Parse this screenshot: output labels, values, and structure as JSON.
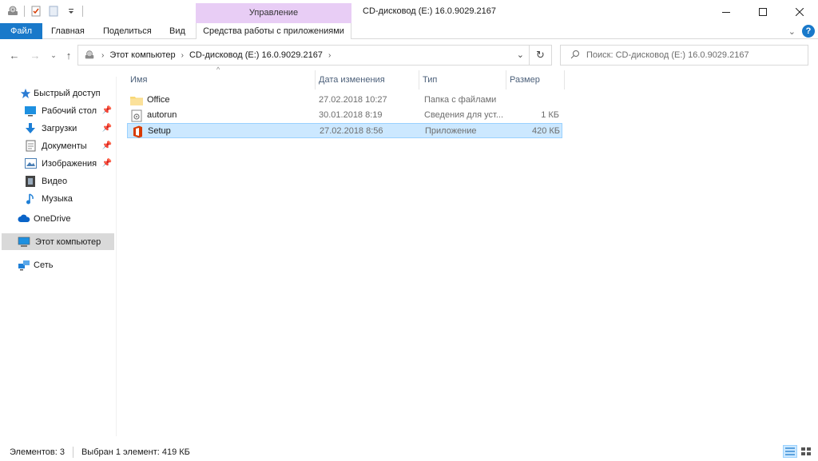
{
  "titlebar": {
    "context_group": "Управление",
    "title": "CD-дисковод (E:) 16.0.9029.2167",
    "qat_icons": [
      "drive-icon",
      "checkmark-doc-icon",
      "blank-doc-icon",
      "customize-dropdown-icon"
    ]
  },
  "ribbon": {
    "tabs": [
      {
        "label": "Файл"
      },
      {
        "label": "Главная"
      },
      {
        "label": "Поделиться"
      },
      {
        "label": "Вид"
      },
      {
        "label": "Средства работы с приложениями"
      }
    ]
  },
  "address": {
    "crumbs": [
      "Этот компьютер",
      "CD-дисковод (E:) 16.0.9029.2167"
    ],
    "search_placeholder": "Поиск: CD-дисковод (E:) 16.0.9029.2167"
  },
  "sidebar": {
    "items": [
      {
        "label": "Быстрый доступ",
        "icon": "star-icon",
        "color": "#2b7cd3"
      },
      {
        "label": "Рабочий стол",
        "icon": "desktop-icon",
        "color": "#1e90e0",
        "pinned": true
      },
      {
        "label": "Загрузки",
        "icon": "download-icon",
        "color": "#1e7fd6",
        "pinned": true
      },
      {
        "label": "Документы",
        "icon": "document-icon",
        "color": "#6b6b6b",
        "pinned": true
      },
      {
        "label": "Изображения",
        "icon": "image-icon",
        "color": "#4a7fb5",
        "pinned": true
      },
      {
        "label": "Видео",
        "icon": "film-icon",
        "color": "#444444"
      },
      {
        "label": "Музыка",
        "icon": "music-icon",
        "color": "#1e7fd6"
      },
      {
        "label": "OneDrive",
        "icon": "cloud-icon",
        "color": "#0a64c8"
      },
      {
        "label": "Этот компьютер",
        "icon": "computer-icon",
        "color": "#1e90e0",
        "selected": true
      },
      {
        "label": "Сеть",
        "icon": "network-icon",
        "color": "#1e7fd6"
      }
    ]
  },
  "columns": {
    "name": "Имя",
    "date": "Дата изменения",
    "type": "Тип",
    "size": "Размер"
  },
  "files": [
    {
      "name": "Office",
      "date": "27.02.2018 10:27",
      "type": "Папка с файлами",
      "size": "",
      "icon": "folder-icon"
    },
    {
      "name": "autorun",
      "date": "30.01.2018 8:19",
      "type": "Сведения для уст...",
      "size": "1 КБ",
      "icon": "settings-file-icon"
    },
    {
      "name": "Setup",
      "date": "27.02.2018 8:56",
      "type": "Приложение",
      "size": "420 КБ",
      "icon": "office-app-icon",
      "selected": true
    }
  ],
  "status": {
    "count": "Элементов: 3",
    "selection": "Выбран 1 элемент: 419 КБ"
  },
  "colors": {
    "accent": "#1979ca",
    "context_tab": "#e8cdf5",
    "selection": "#cce8ff",
    "office_red": "#d83b01",
    "folder": "#f8d775"
  }
}
